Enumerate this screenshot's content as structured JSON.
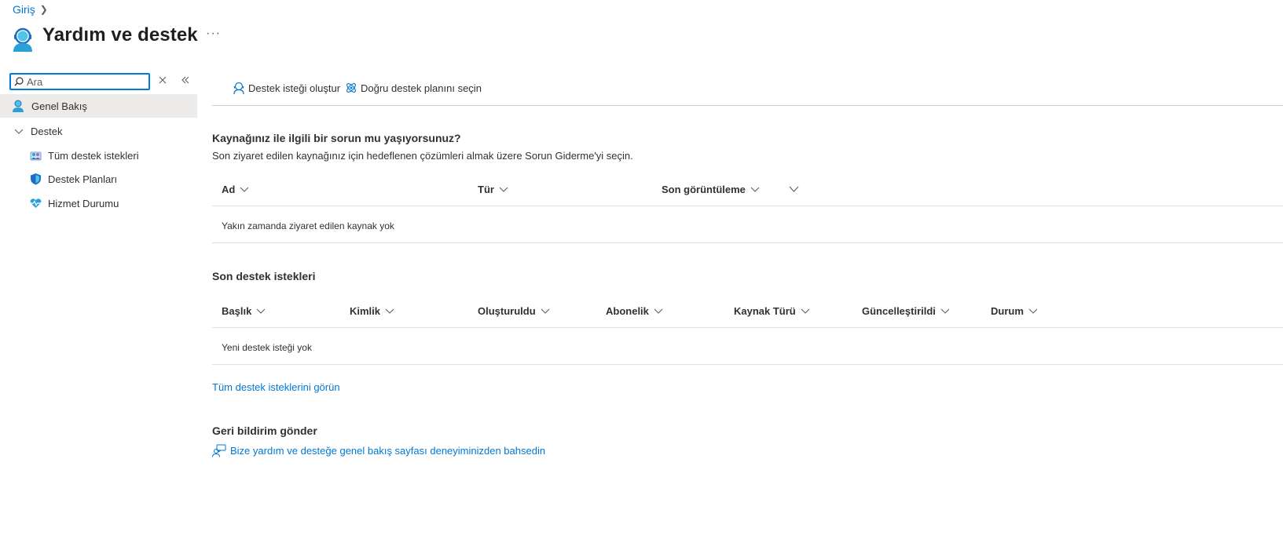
{
  "breadcrumb": {
    "home": "Giriş"
  },
  "header": {
    "title": "Yardım ve destek",
    "more": "···"
  },
  "search": {
    "placeholder": "Ara"
  },
  "sidebar": {
    "overview": "Genel Bakış",
    "group": "Destek",
    "items": [
      {
        "label": "Tüm destek istekleri",
        "icon": "support-requests-icon"
      },
      {
        "label": "Destek Planları",
        "icon": "shield-icon"
      },
      {
        "label": "Hizmet Durumu",
        "icon": "heart-pulse-icon"
      }
    ]
  },
  "commandbar": {
    "create_request": "Destek isteği oluştur",
    "choose_plan": "Doğru destek planını seçin"
  },
  "resources": {
    "heading": "Kaynağınız ile ilgili bir sorun mu yaşıyorsunuz?",
    "description": "Son ziyaret edilen kaynağınız için hedeflenen çözümleri almak üzere Sorun Giderme'yi seçin.",
    "columns": [
      "Ad",
      "Tür",
      "Son görüntüleme"
    ],
    "empty": "Yakın zamanda ziyaret edilen kaynak yok"
  },
  "requests": {
    "heading": "Son destek istekleri",
    "columns": [
      "Başlık",
      "Kimlik",
      "Oluşturuldu",
      "Abonelik",
      "Kaynak Türü",
      "Güncelleştirildi",
      "Durum"
    ],
    "empty": "Yeni destek isteği yok",
    "view_all": "Tüm destek isteklerini görün"
  },
  "feedback": {
    "heading": "Geri bildirim gönder",
    "link": "Bize yardım ve desteğe genel bakış sayfası deneyiminizden bahsedin"
  },
  "colors": {
    "accent": "#0078d4",
    "selected_bg": "#edebe9",
    "text": "#323130"
  }
}
